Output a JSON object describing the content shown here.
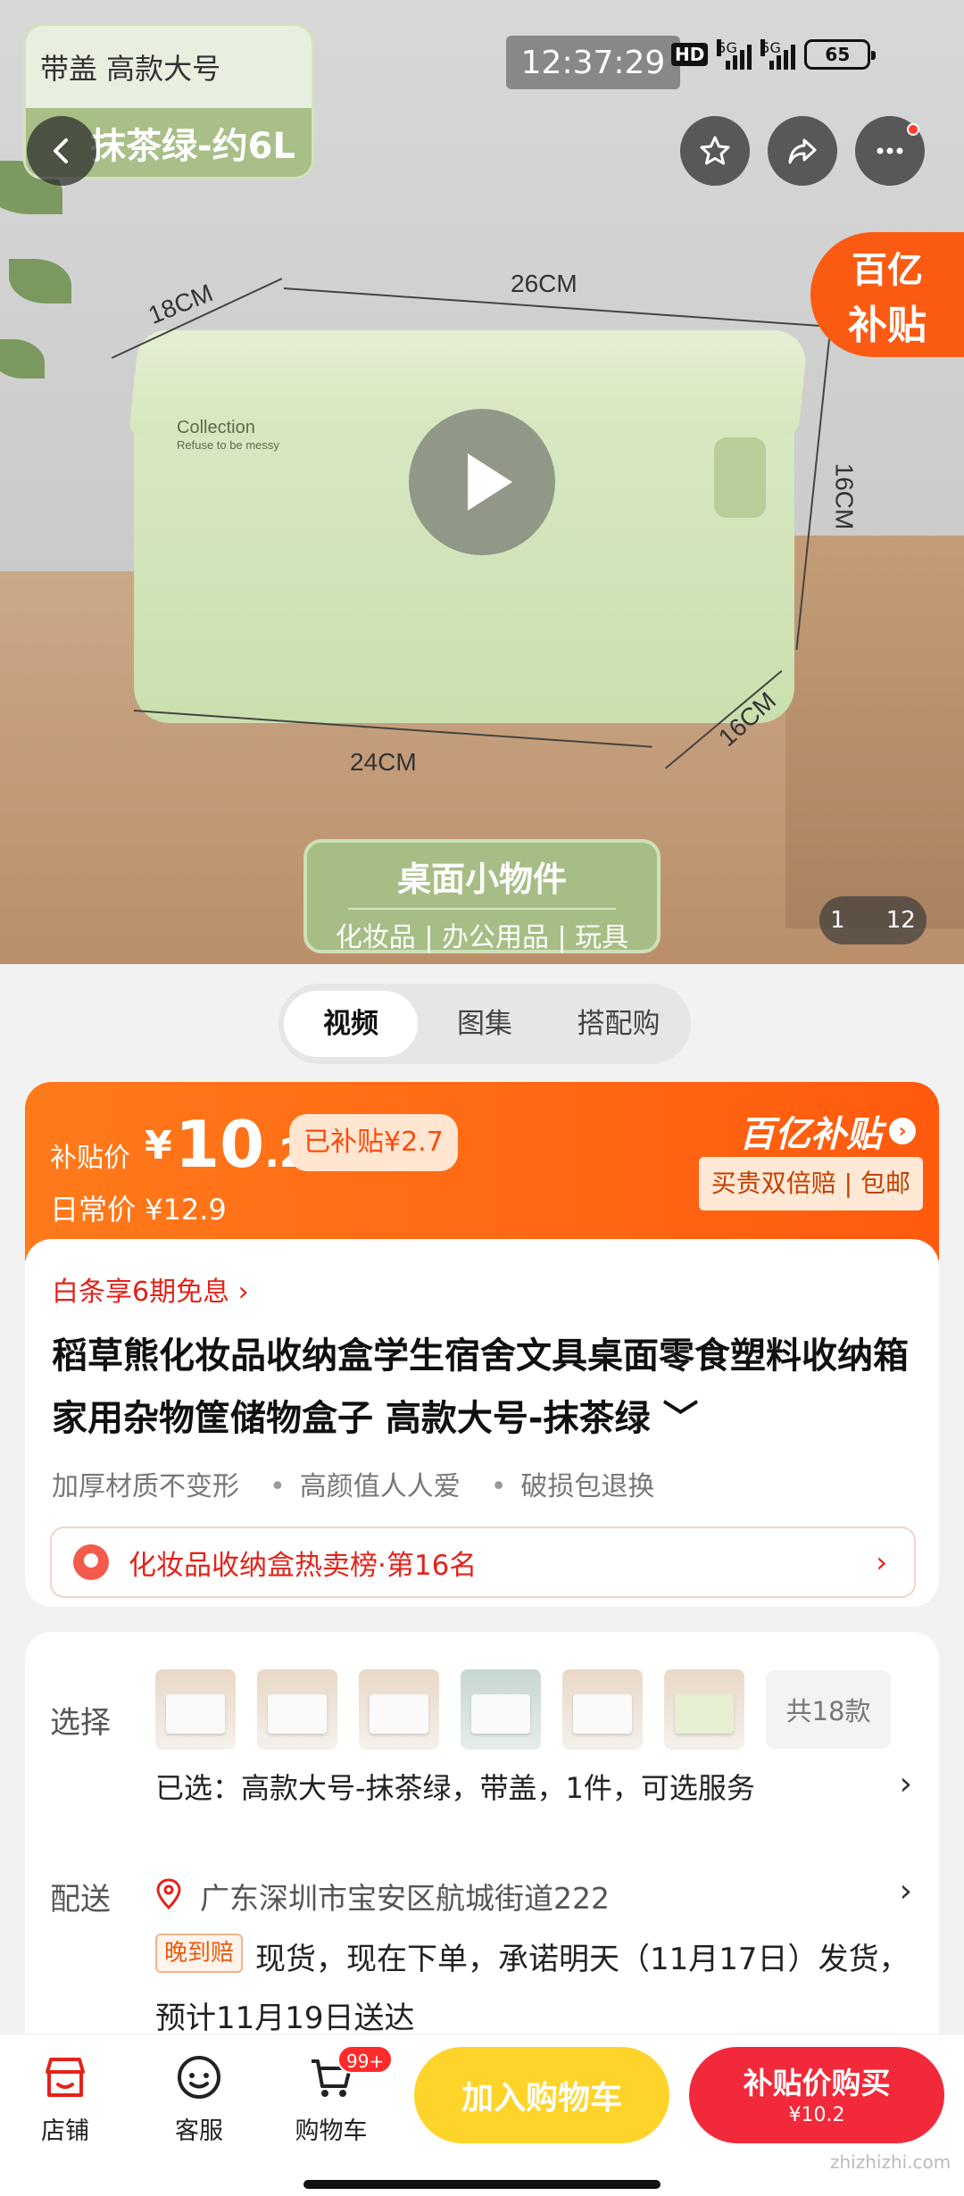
{
  "status_bar": {
    "time": "12:37:29",
    "hd": "HD",
    "network1": "5G",
    "network2": "5G",
    "battery": "65"
  },
  "hero": {
    "spec_card_top": "带盖 高款大号",
    "spec_card_bottom": "抹茶绿-约6L",
    "box_brand": "Collection",
    "box_slogan": "Refuse to be messy",
    "dims": {
      "depth_top": "18CM",
      "width_top": "26CM",
      "height": "16CM",
      "width_bottom": "24CM",
      "depth_bottom": "16CM"
    },
    "tag_line1": "桌面小物件",
    "tag_line2": "化妆品 | 办公用品 | 玩具",
    "subsidy_line1": "百亿",
    "subsidy_line2": "补贴",
    "page_current": "1",
    "page_total": "12"
  },
  "tabs": [
    "视频",
    "图集",
    "搭配购"
  ],
  "price": {
    "label": "补贴价",
    "yen": "¥",
    "int": "10",
    "dec": ".2",
    "subsidy_tag": "已补贴¥2.7",
    "daily": "日常价 ¥12.9",
    "brand": "百亿补贴",
    "brand_arrow": "›",
    "guarantee": "买贵双倍赔 | 包邮"
  },
  "product": {
    "baitiao": "白条享6期免息 ›",
    "title": "稻草熊化妆品收纳盒学生宿舍文具桌面零食塑料收纳箱家用杂物筐储物盒子 高款大号-抹茶绿 ﹀",
    "features": [
      "加厚材质不变形",
      "高颜值人人爱",
      "破损包退换"
    ],
    "rank": "化妆品收纳盒热卖榜·第16名",
    "rank_arrow": "›"
  },
  "options": {
    "select_label": "选择",
    "count": "共18款",
    "selected": "已选：高款大号-抹茶绿，带盖，1件，可选服务",
    "delivery_label": "配送",
    "address": "广东深圳市宝安区航城街道222",
    "late_tag": "晚到赔",
    "shipping": "现货，现在下单，承诺明天（11月17日）发货，预计11月19日送达",
    "arrow": "›"
  },
  "bottom_bar": {
    "store": "店铺",
    "service": "客服",
    "cart": "购物车",
    "cart_badge": "99+",
    "add_cart": "加入购物车",
    "buy_now": "补贴价购买",
    "buy_price": "¥10.2"
  },
  "watermark": "zhizhizhi.com"
}
